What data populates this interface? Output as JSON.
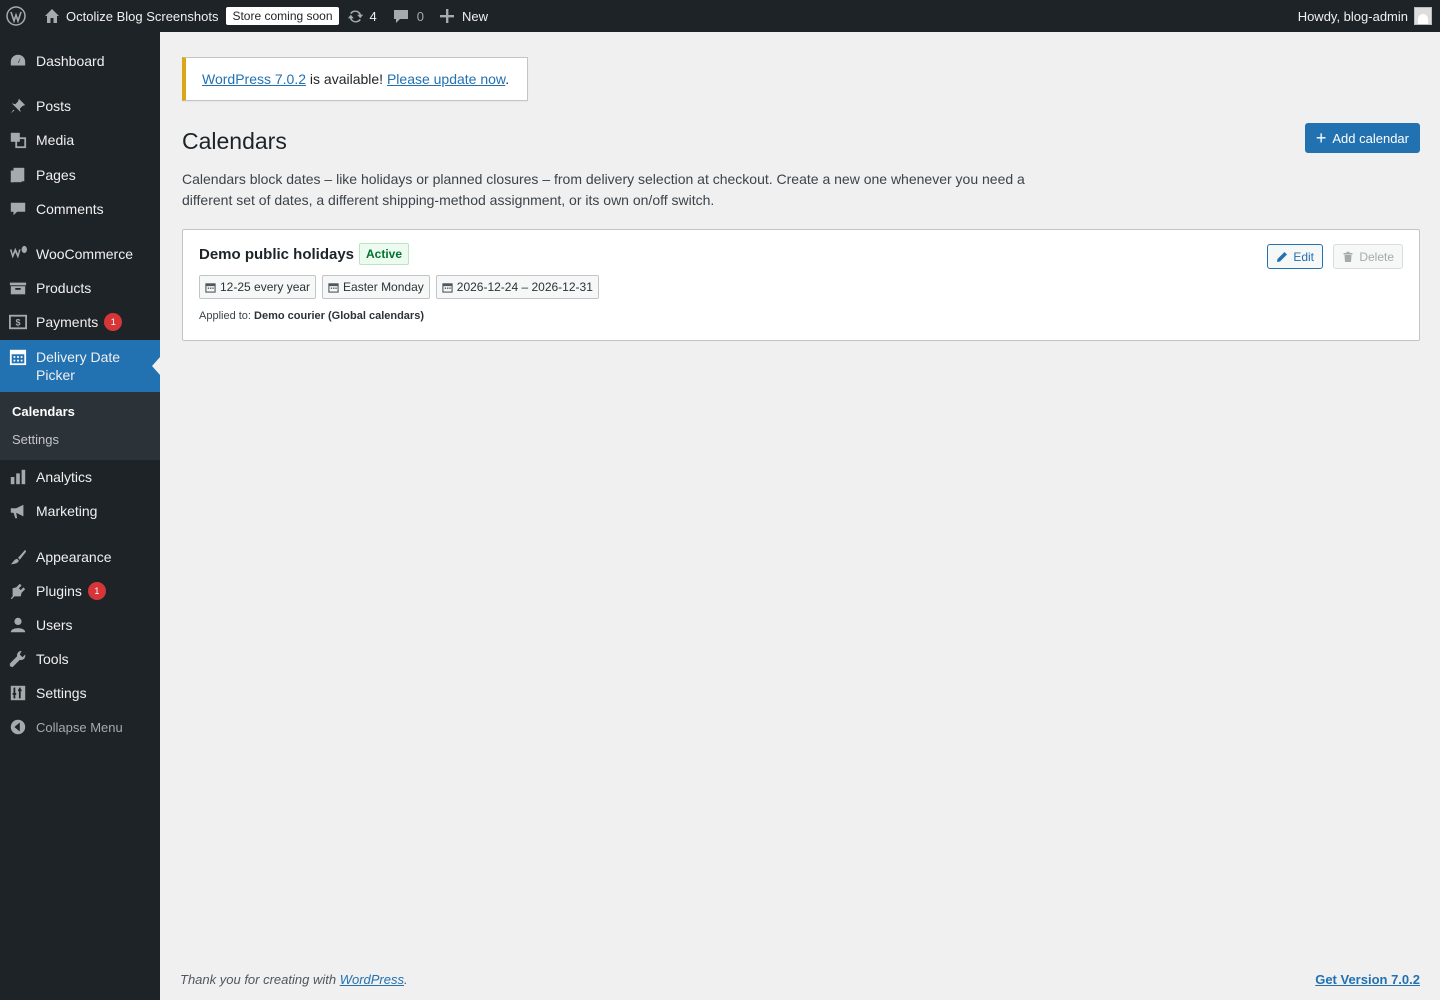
{
  "admin_bar": {
    "site_name": "Octolize Blog Screenshots",
    "store_badge": "Store coming soon",
    "updates_count": "4",
    "comments_count": "0",
    "new_label": "New",
    "greeting": "Howdy, blog-admin"
  },
  "sidebar": {
    "items": [
      {
        "label": "Dashboard",
        "icon": "dashboard-icon"
      },
      {
        "label": "Posts",
        "icon": "pin-icon"
      },
      {
        "label": "Media",
        "icon": "media-icon"
      },
      {
        "label": "Pages",
        "icon": "pages-icon"
      },
      {
        "label": "Comments",
        "icon": "comment-icon"
      },
      {
        "label": "WooCommerce",
        "icon": "woo-icon"
      },
      {
        "label": "Products",
        "icon": "archive-icon"
      },
      {
        "label": "Payments",
        "icon": "money-icon",
        "badge": "1"
      },
      {
        "label": "Delivery Date Picker",
        "icon": "calendar-icon"
      },
      {
        "label": "Analytics",
        "icon": "chart-icon"
      },
      {
        "label": "Marketing",
        "icon": "megaphone-icon"
      },
      {
        "label": "Appearance",
        "icon": "brush-icon"
      },
      {
        "label": "Plugins",
        "icon": "plugin-icon",
        "badge": "1"
      },
      {
        "label": "Users",
        "icon": "user-icon"
      },
      {
        "label": "Tools",
        "icon": "wrench-icon"
      },
      {
        "label": "Settings",
        "icon": "settings-icon"
      }
    ],
    "submenu": [
      "Calendars",
      "Settings"
    ],
    "collapse_label": "Collapse Menu"
  },
  "notice": {
    "link_version": "WordPress 7.0.2",
    "text": " is available! ",
    "link_update": "Please update now",
    "end": "."
  },
  "page": {
    "title": "Calendars",
    "add_button": "Add calendar",
    "description": "Calendars block dates – like holidays or planned closures – from delivery selection at checkout. Create a new one whenever you need a different set of dates, a different shipping-method assignment, or its own on/off switch."
  },
  "calendar": {
    "name": "Demo public holidays",
    "status": "Active",
    "dates": [
      "12-25 every year",
      "Easter Monday",
      "2026-12-24 – 2026-12-31"
    ],
    "applied_prefix": "Applied to:",
    "applied_value": "Demo courier (Global calendars)",
    "edit_label": "Edit",
    "delete_label": "Delete"
  },
  "footer": {
    "thanks_prefix": "Thank you for creating with ",
    "thanks_link": "WordPress",
    "thanks_end": ".",
    "version_link": "Get Version 7.0.2"
  },
  "colors": {
    "admin_bg": "#1d2327",
    "accent": "#2271b1",
    "badge": "#d63638",
    "notice_warning": "#dba617",
    "active_green": "#00742f"
  }
}
